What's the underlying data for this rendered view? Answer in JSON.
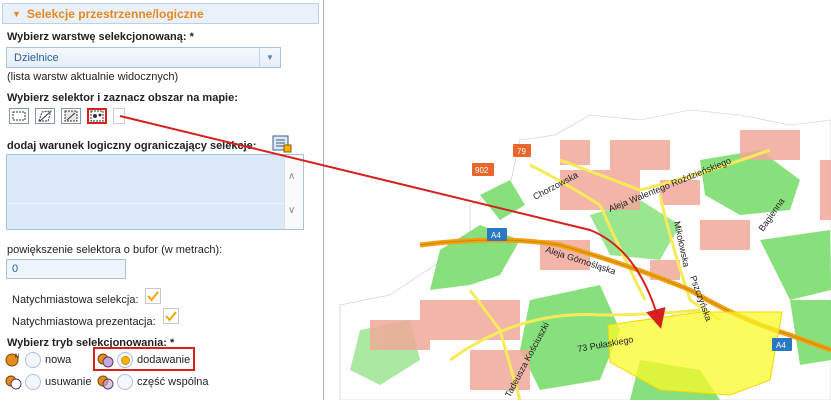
{
  "panel": {
    "title": "Selekcje przestrzenne/logiczne",
    "layer_label": "Wybierz warstwę selekcjonowaną: *",
    "layer_value": "Dzielnice",
    "layer_hint": "(lista warstw aktualnie widocznych)",
    "selector_label": "Wybierz selektor i zaznacz obszar na mapie:",
    "selector_tools": [
      "rectangle-select-icon",
      "polygon-select-icon",
      "freehand-select-icon",
      "feature-select-icon",
      "disabled-select-icon"
    ],
    "logic_label": "dodaj warunek logiczny ograniczający selekcje:",
    "logic_value": "",
    "buffer_label": "powiększenie selektora o bufor (w metrach):",
    "buffer_value": "0",
    "instant_selection_label": "Natychmiastowa selekcja:",
    "instant_selection_checked": true,
    "instant_presentation_label": "Natychmiastowa prezentacja:",
    "instant_presentation_checked": true,
    "mode_label": "Wybierz tryb selekcjonowania: *",
    "modes": [
      {
        "label": "nowa",
        "selected": false
      },
      {
        "label": "dodawanie",
        "selected": true
      },
      {
        "label": "usuwanie",
        "selected": false
      },
      {
        "label": "część wspólna",
        "selected": false
      }
    ]
  },
  "map": {
    "streets": [
      "Chorzowska",
      "Aleja Walentego Roździeńskiego",
      "Bagienna",
      "Aleja Górnośląska",
      "Mikołowska",
      "Pszczyńska",
      "73 Pułaskiego",
      "Tadeusza Kościuszki"
    ],
    "road_shields": [
      "79",
      "902",
      "A4",
      "A4"
    ],
    "colors": {
      "selection": "#fafa28",
      "urban": "#f0a99a",
      "green": "#88e07c",
      "motorway": "#f0a010",
      "arrow": "#d62020"
    }
  }
}
